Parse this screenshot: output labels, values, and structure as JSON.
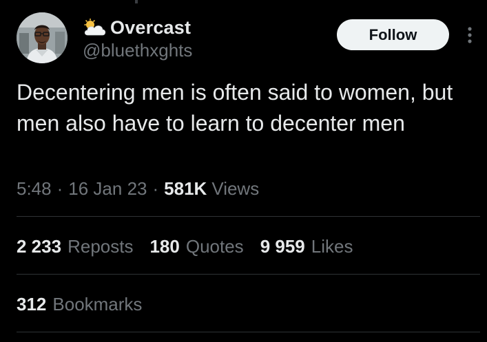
{
  "colors": {
    "background": "#000000",
    "primary_text": "#e7e9ea",
    "secondary_text": "#71767b",
    "divider": "#2f3336",
    "follow_button_bg": "#eff3f4",
    "follow_button_text": "#0f1419"
  },
  "author": {
    "avatar_icon": "profile-photo",
    "name_emoji_icon": "sun-behind-cloud-icon",
    "display_name": "Overcast",
    "handle": "@bluethxghts"
  },
  "actions": {
    "follow_label": "Follow",
    "more_icon": "more-vertical-icon"
  },
  "tweet": {
    "text": "Decentering men is often said to women, but men also have to learn to decenter men"
  },
  "meta": {
    "time": "5:48",
    "separator": "·",
    "date": "16 Jan 23",
    "views_count": "581K",
    "views_label": "Views"
  },
  "stats": {
    "reposts_count": "2 233",
    "reposts_label": "Reposts",
    "quotes_count": "180",
    "quotes_label": "Quotes",
    "likes_count": "9 959",
    "likes_label": "Likes",
    "bookmarks_count": "312",
    "bookmarks_label": "Bookmarks"
  }
}
